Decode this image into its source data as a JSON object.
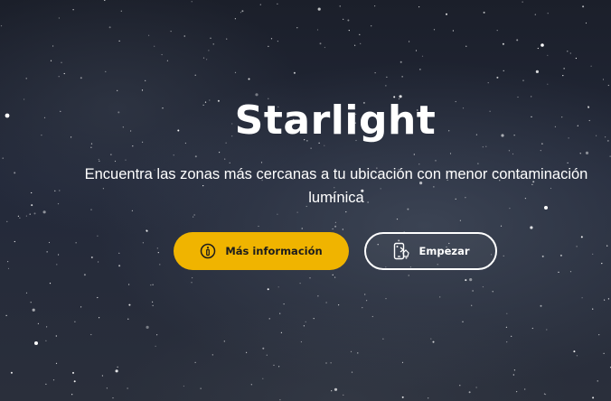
{
  "hero": {
    "title": "Starlight",
    "subtitle": "Encuentra las zonas más cercanas a tu ubicación con menor contaminación lumínica"
  },
  "buttons": {
    "info": {
      "label": "Más información",
      "icon": "info-icon",
      "color": "#f0b400"
    },
    "start": {
      "label": "Empezar",
      "icon": "phone-map-icon",
      "color": "#ffffff"
    }
  },
  "colors": {
    "accent": "#f0b400",
    "text": "#ffffff",
    "background": "#1c2230"
  }
}
